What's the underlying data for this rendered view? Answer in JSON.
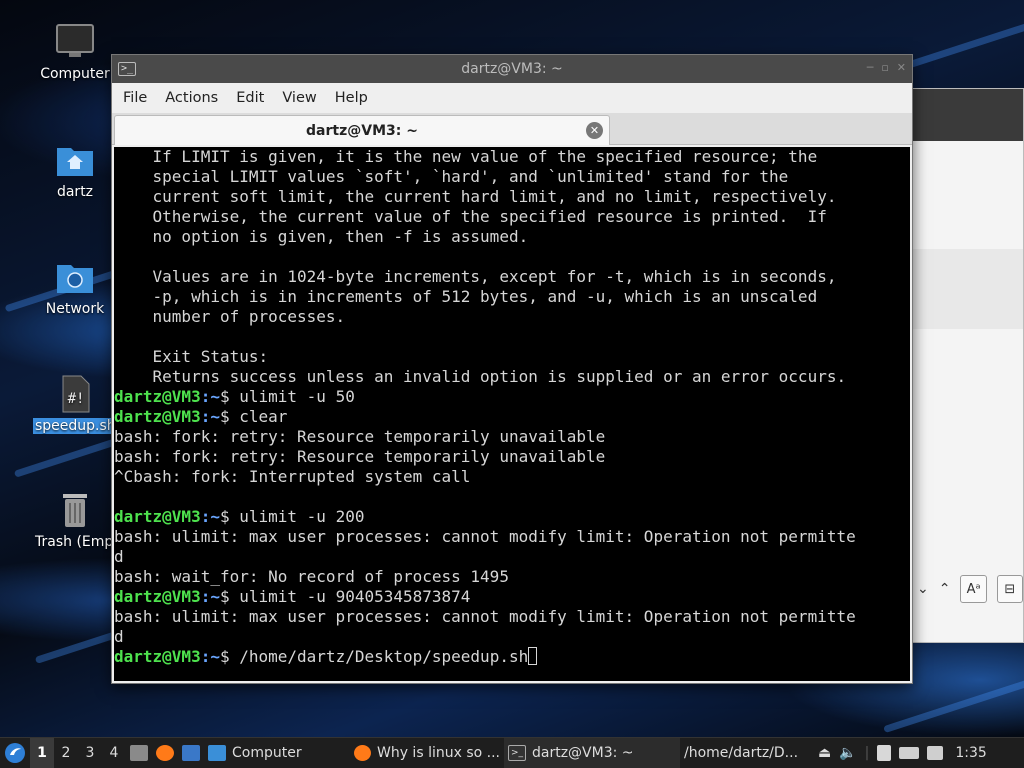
{
  "desktop": {
    "icons": [
      {
        "label": "Computer",
        "icon": "computer-icon"
      },
      {
        "label": "dartz",
        "icon": "home-folder-icon"
      },
      {
        "label": "Network",
        "icon": "network-folder-icon"
      },
      {
        "label": "speedup.sh",
        "icon": "script-file-icon"
      },
      {
        "label": "Trash (Empty)",
        "icon": "trash-icon"
      }
    ]
  },
  "terminal": {
    "window_title": "dartz@VM3: ~",
    "menu": [
      "File",
      "Actions",
      "Edit",
      "View",
      "Help"
    ],
    "tab_title": "dartz@VM3: ~",
    "prompt_user": "dartz@VM3",
    "prompt_path": ":~",
    "prompt_symbol": "$ ",
    "lines": [
      {
        "text": "    If LIMIT is given, it is the new value of the specified resource; the"
      },
      {
        "text": "    special LIMIT values `soft', `hard', and `unlimited' stand for the"
      },
      {
        "text": "    current soft limit, the current hard limit, and no limit, respectively."
      },
      {
        "text": "    Otherwise, the current value of the specified resource is printed.  If"
      },
      {
        "text": "    no option is given, then -f is assumed."
      },
      {
        "text": ""
      },
      {
        "text": "    Values are in 1024-byte increments, except for -t, which is in seconds,"
      },
      {
        "text": "    -p, which is in increments of 512 bytes, and -u, which is an unscaled"
      },
      {
        "text": "    number of processes."
      },
      {
        "text": ""
      },
      {
        "text": "    Exit Status:"
      },
      {
        "text": "    Returns success unless an invalid option is supplied or an error occurs."
      },
      {
        "prompt": true,
        "text": "ulimit -u 50"
      },
      {
        "prompt": true,
        "text": "clear"
      },
      {
        "text": "bash: fork: retry: Resource temporarily unavailable"
      },
      {
        "text": "bash: fork: retry: Resource temporarily unavailable"
      },
      {
        "text": "^Cbash: fork: Interrupted system call"
      },
      {
        "text": ""
      },
      {
        "prompt": true,
        "text": "ulimit -u 200"
      },
      {
        "text": "bash: ulimit: max user processes: cannot modify limit: Operation not permitte"
      },
      {
        "text": "d"
      },
      {
        "text": "bash: wait_for: No record of process 1495"
      },
      {
        "prompt": true,
        "text": "ulimit -u 90405345873874"
      },
      {
        "text": "bash: ulimit: max user processes: cannot modify limit: Operation not permitte"
      },
      {
        "text": "d"
      },
      {
        "prompt": true,
        "text": "/home/dartz/Desktop/speedup.sh",
        "cursor": true
      }
    ]
  },
  "taskbar": {
    "workspaces": [
      "1",
      "2",
      "3",
      "4"
    ],
    "tasks": [
      {
        "label": "Computer",
        "icon": "folder-icon"
      },
      {
        "label": "Why is linux so ...",
        "icon": "firefox-icon"
      },
      {
        "label": "dartz@VM3: ~",
        "icon": "terminal-icon"
      },
      {
        "label": "/home/dartz/D...",
        "icon": "folder-icon"
      }
    ],
    "clock": "1:35"
  },
  "colors": {
    "prompt_user": "#4ee24e",
    "prompt_path": "#6aa6ff",
    "terminal_bg": "#000000"
  }
}
